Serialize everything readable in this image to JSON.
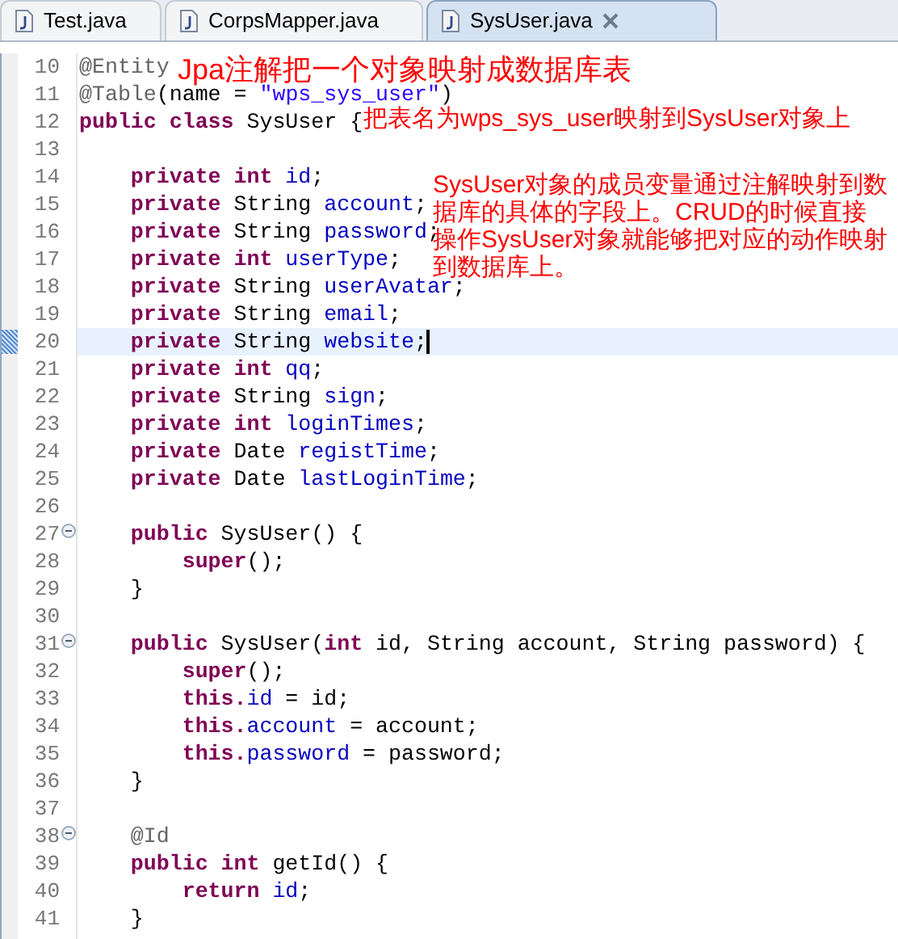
{
  "tabs": [
    {
      "label": "Test.java",
      "selected": false
    },
    {
      "label": "CorpsMapper.java",
      "selected": false
    },
    {
      "label": "SysUser.java",
      "selected": true
    }
  ],
  "editor": {
    "lines": [
      {
        "number": "10",
        "current": false,
        "foldable": false,
        "tokens": [
          {
            "kind": "annotation",
            "text": "@Entity"
          }
        ]
      },
      {
        "number": "11",
        "current": false,
        "foldable": false,
        "tokens": [
          {
            "kind": "annotation",
            "text": "@Table"
          },
          {
            "kind": "plain",
            "text": "(name = "
          },
          {
            "kind": "string",
            "text": "\"wps_sys_user\""
          },
          {
            "kind": "plain",
            "text": ")"
          }
        ]
      },
      {
        "number": "12",
        "current": false,
        "foldable": false,
        "tokens": [
          {
            "kind": "keyword",
            "text": "public class"
          },
          {
            "kind": "plain",
            "text": " SysUser {"
          }
        ]
      },
      {
        "number": "13",
        "current": false,
        "foldable": false
      },
      {
        "number": "14",
        "current": false,
        "foldable": false,
        "tokens": [
          {
            "kind": "keyword",
            "text": "    private int"
          },
          {
            "kind": "field",
            "text": " id"
          },
          {
            "kind": "plain",
            "text": ";"
          }
        ]
      },
      {
        "number": "15",
        "current": false,
        "foldable": false,
        "tokens": [
          {
            "kind": "keyword",
            "text": "    private"
          },
          {
            "kind": "plain",
            "text": " String"
          },
          {
            "kind": "field",
            "text": " account"
          },
          {
            "kind": "plain",
            "text": ";"
          }
        ]
      },
      {
        "number": "16",
        "current": false,
        "foldable": false,
        "tokens": [
          {
            "kind": "keyword",
            "text": "    private"
          },
          {
            "kind": "plain",
            "text": " String"
          },
          {
            "kind": "field",
            "text": " password"
          },
          {
            "kind": "plain",
            "text": ";"
          }
        ]
      },
      {
        "number": "17",
        "current": false,
        "foldable": false,
        "tokens": [
          {
            "kind": "keyword",
            "text": "    private int"
          },
          {
            "kind": "field",
            "text": " userType"
          },
          {
            "kind": "plain",
            "text": ";"
          }
        ]
      },
      {
        "number": "18",
        "current": false,
        "foldable": false,
        "tokens": [
          {
            "kind": "keyword",
            "text": "    private"
          },
          {
            "kind": "plain",
            "text": " String"
          },
          {
            "kind": "field",
            "text": " userAvatar"
          },
          {
            "kind": "plain",
            "text": ";"
          }
        ]
      },
      {
        "number": "19",
        "current": false,
        "foldable": false,
        "tokens": [
          {
            "kind": "keyword",
            "text": "    private"
          },
          {
            "kind": "plain",
            "text": " String"
          },
          {
            "kind": "field",
            "text": " email"
          },
          {
            "kind": "plain",
            "text": ";"
          }
        ]
      },
      {
        "number": "20",
        "current": true,
        "foldable": false,
        "tokens": [
          {
            "kind": "keyword",
            "text": "    private"
          },
          {
            "kind": "plain",
            "text": " String"
          },
          {
            "kind": "field",
            "text": " website"
          },
          {
            "kind": "plain",
            "text": ";"
          }
        ]
      },
      {
        "number": "21",
        "current": false,
        "foldable": false,
        "tokens": [
          {
            "kind": "keyword",
            "text": "    private int"
          },
          {
            "kind": "field",
            "text": " qq"
          },
          {
            "kind": "plain",
            "text": ";"
          }
        ]
      },
      {
        "number": "22",
        "current": false,
        "foldable": false,
        "tokens": [
          {
            "kind": "keyword",
            "text": "    private"
          },
          {
            "kind": "plain",
            "text": " String"
          },
          {
            "kind": "field",
            "text": " sign"
          },
          {
            "kind": "plain",
            "text": ";"
          }
        ]
      },
      {
        "number": "23",
        "current": false,
        "foldable": false,
        "tokens": [
          {
            "kind": "keyword",
            "text": "    private int"
          },
          {
            "kind": "field",
            "text": " loginTimes"
          },
          {
            "kind": "plain",
            "text": ";"
          }
        ]
      },
      {
        "number": "24",
        "current": false,
        "foldable": false,
        "tokens": [
          {
            "kind": "keyword",
            "text": "    private"
          },
          {
            "kind": "plain",
            "text": " Date"
          },
          {
            "kind": "field",
            "text": " registTime"
          },
          {
            "kind": "plain",
            "text": ";"
          }
        ]
      },
      {
        "number": "25",
        "current": false,
        "foldable": false,
        "tokens": [
          {
            "kind": "keyword",
            "text": "    private"
          },
          {
            "kind": "plain",
            "text": " Date"
          },
          {
            "kind": "field",
            "text": " lastLoginTime"
          },
          {
            "kind": "plain",
            "text": ";"
          }
        ]
      },
      {
        "number": "26",
        "current": false,
        "foldable": false
      },
      {
        "number": "27",
        "current": false,
        "foldable": true,
        "tokens": [
          {
            "kind": "keyword",
            "text": "    public"
          },
          {
            "kind": "plain",
            "text": " SysUser() {"
          }
        ]
      },
      {
        "number": "28",
        "current": false,
        "foldable": false,
        "tokens": [
          {
            "kind": "keyword",
            "text": "        super"
          },
          {
            "kind": "plain",
            "text": "();"
          }
        ]
      },
      {
        "number": "29",
        "current": false,
        "foldable": false,
        "tokens": [
          {
            "kind": "plain",
            "text": "    }"
          }
        ]
      },
      {
        "number": "30",
        "current": false,
        "foldable": false
      },
      {
        "number": "31",
        "current": false,
        "foldable": true,
        "tokens": [
          {
            "kind": "keyword",
            "text": "    public"
          },
          {
            "kind": "plain",
            "text": " SysUser("
          },
          {
            "kind": "keyword",
            "text": "int"
          },
          {
            "kind": "plain",
            "text": " id, String account, String password) {"
          }
        ]
      },
      {
        "number": "32",
        "current": false,
        "foldable": false,
        "tokens": [
          {
            "kind": "keyword",
            "text": "        super"
          },
          {
            "kind": "plain",
            "text": "();"
          }
        ]
      },
      {
        "number": "33",
        "current": false,
        "foldable": false,
        "tokens": [
          {
            "kind": "keyword",
            "text": "        this."
          },
          {
            "kind": "field",
            "text": "id"
          },
          {
            "kind": "plain",
            "text": " = id;"
          }
        ]
      },
      {
        "number": "34",
        "current": false,
        "foldable": false,
        "tokens": [
          {
            "kind": "keyword",
            "text": "        this."
          },
          {
            "kind": "field",
            "text": "account"
          },
          {
            "kind": "plain",
            "text": " = account;"
          }
        ]
      },
      {
        "number": "35",
        "current": false,
        "foldable": false,
        "tokens": [
          {
            "kind": "keyword",
            "text": "        this."
          },
          {
            "kind": "field",
            "text": "password"
          },
          {
            "kind": "plain",
            "text": " = password;"
          }
        ]
      },
      {
        "number": "36",
        "current": false,
        "foldable": false,
        "tokens": [
          {
            "kind": "plain",
            "text": "    }"
          }
        ]
      },
      {
        "number": "37",
        "current": false,
        "foldable": false
      },
      {
        "number": "38",
        "current": false,
        "foldable": true,
        "tokens": [
          {
            "kind": "annotation",
            "text": "    @Id"
          }
        ]
      },
      {
        "number": "39",
        "current": false,
        "foldable": false,
        "tokens": [
          {
            "kind": "keyword",
            "text": "    public int"
          },
          {
            "kind": "plain",
            "text": " getId() {"
          }
        ]
      },
      {
        "number": "40",
        "current": false,
        "foldable": false,
        "tokens": [
          {
            "kind": "keyword",
            "text": "        return"
          },
          {
            "kind": "field",
            "text": " id"
          },
          {
            "kind": "plain",
            "text": ";"
          }
        ]
      },
      {
        "number": "41",
        "current": false,
        "foldable": false,
        "tokens": [
          {
            "kind": "plain",
            "text": "    }"
          }
        ]
      }
    ]
  },
  "notes": [
    {
      "text": "Jpa注解把一个对象映射成数据库表"
    },
    {
      "text": "把表名为wps_sys_user映射到SysUser对象上"
    },
    {
      "text": "SysUser对象的成员变量通过注解映射到数据库的具体的字段上。CRUD的时候直接操作SysUser对象就能够把对应的动作映射到数据库上。"
    }
  ]
}
